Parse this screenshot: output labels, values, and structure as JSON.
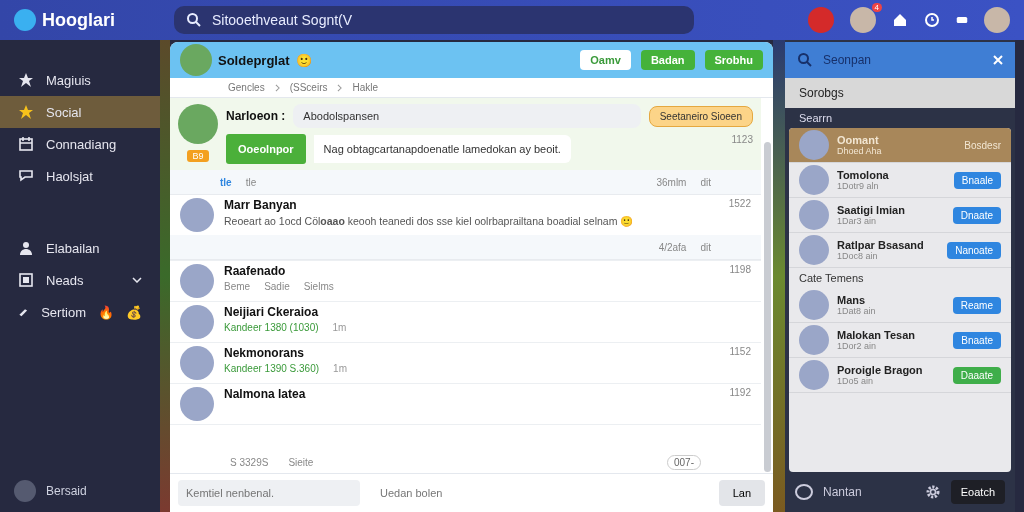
{
  "app": {
    "logo": "Hooglari",
    "search": "Sitooethveaut Sognt(V",
    "notification_count": "4"
  },
  "sidebar": {
    "items": [
      {
        "label": "Magiuis",
        "selected": false
      },
      {
        "label": "Social",
        "selected": true
      },
      {
        "label": "Connadiang",
        "selected": false
      },
      {
        "label": "Haolsjat",
        "selected": false
      },
      {
        "label": "Elabailan",
        "selected": false
      },
      {
        "label": "Neads",
        "selected": false,
        "expandable": true
      },
      {
        "label": "Sertiom",
        "selected": false,
        "emojis": [
          "🔥",
          "💰"
        ]
      }
    ],
    "footer": "Bersaid"
  },
  "chat": {
    "title": "Soldeprglat",
    "title_emoji": "🙂",
    "buttons": [
      {
        "label": "Oamv",
        "kind": "outline"
      },
      {
        "label": "Badan",
        "kind": "green"
      },
      {
        "label": "Srobhu",
        "kind": "green"
      }
    ],
    "breadcrumbs": [
      "Gencles",
      "(SSceirs",
      "Hakle"
    ],
    "composer_post": {
      "name": "Narloeon :",
      "input": "Abodolspansen",
      "tag": "Seetaneiro Sioeen",
      "badge": "B9",
      "action": "Ooeolnpor",
      "message": "Nag obtagcartanapdoenatle lamedokan ay beoit.",
      "time": "1123",
      "reactions": [
        {
          "label": "tle",
          "selected": true
        },
        {
          "label": "tle",
          "selected": false
        }
      ],
      "meta": "36mlm",
      "meta2": "dit"
    },
    "posts": [
      {
        "name": "Marr Banyan",
        "text": "Reoeart ao 1ocd Cöl**oaao** keooh teanedi dos sse kiel oolrbaprailtana boadial selnam 🙂",
        "time": "1522",
        "meta": "4/2afa",
        "meta2": "dit"
      },
      {
        "name": "Raafenado",
        "actions": [
          "Beme",
          "Sadie",
          "Sielms"
        ],
        "time": "1198"
      },
      {
        "name": "Neijiari Ckeraioa",
        "sub": "Kandeer 1380 (1030)",
        "ago": "1m"
      },
      {
        "name": "Nekmonorans",
        "sub": "Kandeer 1390 S.360)",
        "ago": "1m",
        "time": "1152"
      },
      {
        "name": "Nalmona latea",
        "time": "1192"
      }
    ],
    "footer_row": {
      "left": "S 3329S",
      "mid": "Sieite",
      "count": "007-"
    },
    "input": {
      "placeholder": "Kemtiel nenbenal."
    },
    "attach": "Uedan bolen",
    "send": "Lan"
  },
  "panel": {
    "search": "Seonpan",
    "top_item": "Sorobgs",
    "section": "Searrn",
    "items": [
      {
        "name": "Oomant",
        "sub": "Dhoed Aha",
        "action": "Bosdesr",
        "selected": true
      },
      {
        "name": "Tomolona",
        "sub": "1Dotr9 aln",
        "action": "Bnaale",
        "selected": false,
        "color": "#2f86e0"
      },
      {
        "name": "Saatigi lmian",
        "sub": "1Dar3 ain",
        "action": "Dnaate",
        "selected": false,
        "color": "#2f86e0"
      },
      {
        "name": "Ratlpar Bsasand",
        "sub": "1Doc8 ain",
        "action": "Nanoate",
        "selected": false,
        "color": "#2f86e0"
      }
    ],
    "group": "Cate Temens",
    "group_items": [
      {
        "name": "Mans",
        "sub": "1Dat8 ain",
        "action": "Reame",
        "selected": false,
        "color": "#2f86e0"
      },
      {
        "name": "Malokan Tesan",
        "sub": "1Dor2 ain",
        "action": "Bnaate",
        "selected": false,
        "color": "#2f86e0"
      },
      {
        "name": "Poroigle Bragon",
        "sub": "1Do5 ain",
        "action": "Daaate",
        "selected": false,
        "color": "#3fae4a"
      }
    ],
    "footer": "Nantan",
    "footer_button": "Eoatch"
  }
}
